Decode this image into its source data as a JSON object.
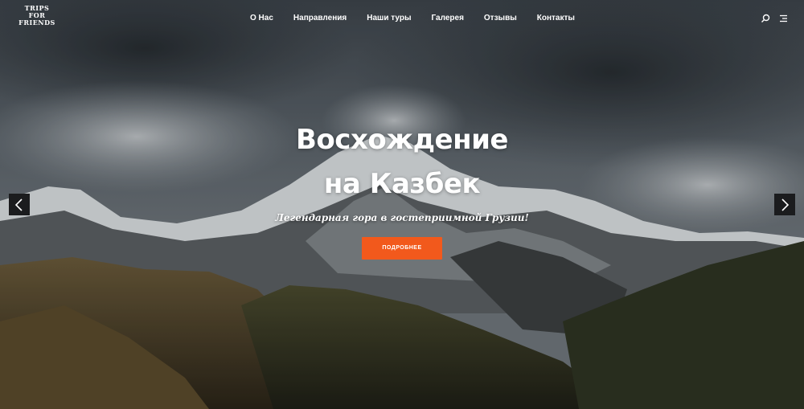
{
  "logo": {
    "lines": [
      "TRIPS",
      "FOR",
      "FRIENDS"
    ]
  },
  "nav": {
    "items": [
      "О Нас",
      "Направления",
      "Наши туры",
      "Галерея",
      "Отзывы",
      "Контакты"
    ]
  },
  "header_icons": [
    "search-icon",
    "menu-icon"
  ],
  "hero": {
    "title_line1": "Восхождение",
    "title_line2": "на Казбек",
    "subtitle": "Легендарная гора в гостеприимной Грузии!",
    "button_label": "ПОДРОБНЕЕ",
    "prev_icon": "chevron-left-icon",
    "next_icon": "chevron-right-icon"
  },
  "colors": {
    "accent": "#f2591c",
    "arrow_bg": "#1b1c1e",
    "text": "#ffffff"
  }
}
